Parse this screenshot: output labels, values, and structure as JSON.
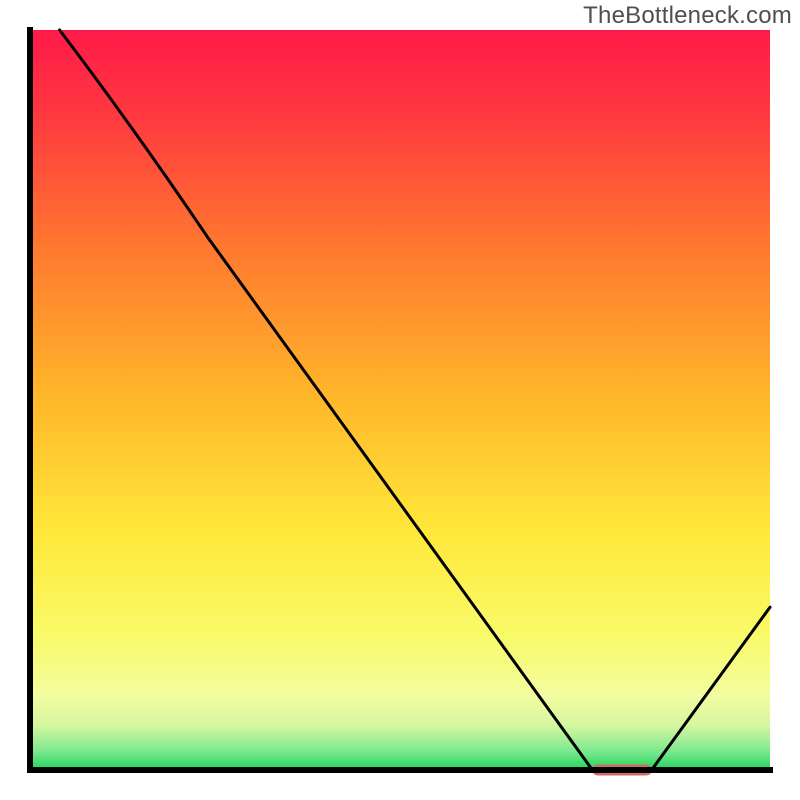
{
  "watermark": "TheBottleneck.com",
  "chart_data": {
    "type": "line",
    "title": "",
    "xlabel": "",
    "ylabel": "",
    "xlim": [
      0,
      100
    ],
    "ylim": [
      0,
      100
    ],
    "series": [
      {
        "name": "curve",
        "x": [
          4,
          24,
          76,
          84,
          100
        ],
        "y": [
          100,
          72,
          0,
          0,
          22
        ]
      }
    ],
    "marker": {
      "name": "optimal-zone",
      "x_start": 76,
      "x_end": 84,
      "y": 0,
      "color": "#d16a6a"
    },
    "gradient_stops": [
      {
        "offset": 0.0,
        "color": "#ff1a4a"
      },
      {
        "offset": 0.12,
        "color": "#ff3a3f"
      },
      {
        "offset": 0.3,
        "color": "#ff7a2f"
      },
      {
        "offset": 0.5,
        "color": "#ffb82a"
      },
      {
        "offset": 0.68,
        "color": "#ffe83a"
      },
      {
        "offset": 0.82,
        "color": "#f9fb6a"
      },
      {
        "offset": 0.9,
        "color": "#f3fca0"
      },
      {
        "offset": 0.94,
        "color": "#d4f7a0"
      },
      {
        "offset": 0.975,
        "color": "#7be88e"
      },
      {
        "offset": 1.0,
        "color": "#1ed65a"
      }
    ],
    "grid": false,
    "legend": false
  }
}
